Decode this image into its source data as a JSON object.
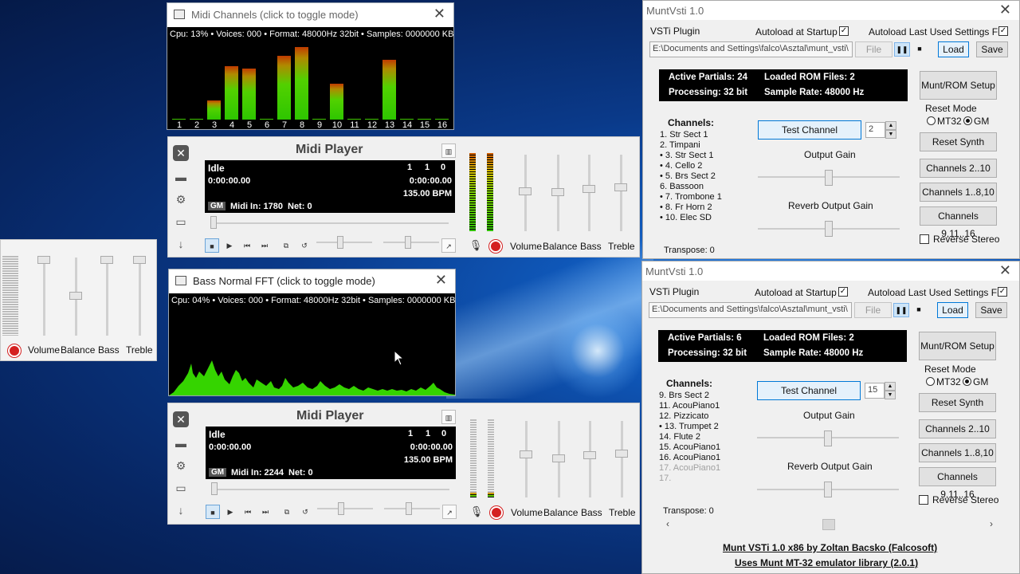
{
  "midi_channels": {
    "title": "Midi Channels (click to toggle mode)",
    "status": "Cpu: 13% • Voices: 000 • Format: 48000Hz 32bit • Samples: 0000000 KB",
    "channels": [
      "1",
      "2",
      "3",
      "4",
      "5",
      "6",
      "7",
      "8",
      "9",
      "10",
      "11",
      "12",
      "13",
      "14",
      "15",
      "16"
    ],
    "levels": [
      0,
      0,
      0.25,
      0.7,
      0.67,
      0,
      0.83,
      0.95,
      0,
      0.47,
      0,
      0,
      0.78,
      0,
      0,
      0
    ]
  },
  "bass_fft": {
    "title": "Bass Normal FFT (click to toggle mode)",
    "status": "Cpu: 04% • Voices: 000 • Format: 48000Hz 32bit • Samples: 0000000 KB"
  },
  "player1": {
    "title": "Midi Player",
    "state": "Idle",
    "time": "0:00:00.00",
    "pos1": "1",
    "pos2": "1",
    "pos3": "0",
    "time2": "0:00:00.00",
    "bpm": "135.00 BPM",
    "badge": "GM",
    "midi_in": "Midi In: 1780",
    "net": "Net: 0",
    "labels": {
      "volume": "Volume",
      "balance": "Balance",
      "bass": "Bass",
      "treble": "Treble"
    }
  },
  "player2": {
    "title": "Midi Player",
    "state": "Idle",
    "time": "0:00:00.00",
    "pos1": "1",
    "pos2": "1",
    "pos3": "0",
    "time2": "0:00:00.00",
    "bpm": "135.00 BPM",
    "badge": "GM",
    "midi_in": "Midi In: 2244",
    "net": "Net: 0",
    "labels": {
      "volume": "Volume",
      "balance": "Balance",
      "bass": "Bass",
      "treble": "Treble"
    }
  },
  "left_mixer": {
    "labels": {
      "volume": "Volume",
      "balance": "Balance",
      "bass": "Bass",
      "treble": "Treble"
    }
  },
  "munt1": {
    "title": "MuntVsti 1.0",
    "vsti_plugin": "VSTi Plugin",
    "autoload_startup": "Autoload at Startup",
    "autoload_last": "Autoload Last Used Settings File",
    "path": "E:\\Documents and Settings\\falco\\Asztal\\munt_vsti\\",
    "file": "File",
    "load": "Load",
    "save": "Save",
    "active_partials": "Active Partials: 24",
    "loaded_rom": "Loaded ROM Files: 2",
    "processing": "Processing: 32 bit",
    "sample_rate": "Sample Rate: 48000 Hz",
    "munt_rom_setup": "Munt/ROM Setup",
    "reset_mode": "Reset Mode",
    "mt32": "MT32",
    "gm": "GM",
    "reset_synth": "Reset Synth",
    "ch2_10": "Channels 2..10",
    "ch1_8_10": "Channels 1..8,10",
    "ch9_11_16": "Channels 9,11..16",
    "reverse_stereo": "Reverse Stereo",
    "channels_label": "Channels:",
    "test_channel": "Test Channel",
    "test_value": "2",
    "output_gain": "Output Gain",
    "reverb_output_gain": "Reverb Output Gain",
    "transpose": "Transpose: 0",
    "channels": [
      {
        "text": "1. Str Sect 1",
        "active": false
      },
      {
        "text": "2. Timpani",
        "active": false
      },
      {
        "text": "3. Str Sect 1",
        "active": true
      },
      {
        "text": "4. Cello 2",
        "active": true
      },
      {
        "text": "5. Brs Sect 2",
        "active": true
      },
      {
        "text": "6. Bassoon",
        "active": false
      },
      {
        "text": "7. Trombone 1",
        "active": true
      },
      {
        "text": "8. Fr Horn 2",
        "active": true
      },
      {
        "text": "10. Elec SD",
        "active": true
      }
    ]
  },
  "munt2": {
    "title": "MuntVsti 1.0",
    "vsti_plugin": "VSTi Plugin",
    "autoload_startup": "Autoload at Startup",
    "autoload_last": "Autoload Last Used Settings File",
    "path": "E:\\Documents and Settings\\falco\\Asztal\\munt_vsti\\",
    "file": "File",
    "load": "Load",
    "save": "Save",
    "active_partials": "Active Partials: 6",
    "loaded_rom": "Loaded ROM Files: 2",
    "processing": "Processing: 32 bit",
    "sample_rate": "Sample Rate: 48000 Hz",
    "munt_rom_setup": "Munt/ROM Setup",
    "reset_mode": "Reset Mode",
    "mt32": "MT32",
    "gm": "GM",
    "reset_synth": "Reset Synth",
    "ch2_10": "Channels 2..10",
    "ch1_8_10": "Channels 1..8,10",
    "ch9_11_16": "Channels 9,11..16",
    "reverse_stereo": "Reverse Stereo",
    "channels_label": "Channels:",
    "test_channel": "Test Channel",
    "test_value": "15",
    "output_gain": "Output Gain",
    "reverb_output_gain": "Reverb Output Gain",
    "transpose": "Transpose: 0",
    "channels": [
      {
        "text": "9. Brs Sect 2",
        "active": false
      },
      {
        "text": "11. AcouPiano1",
        "active": false
      },
      {
        "text": "12. Pizzicato",
        "active": false
      },
      {
        "text": "13. Trumpet 2",
        "active": true
      },
      {
        "text": "14. Flute 2",
        "active": false
      },
      {
        "text": "15. AcouPiano1",
        "active": false
      },
      {
        "text": "16. AcouPiano1",
        "active": false
      },
      {
        "text": "17. AcouPiano1",
        "active": false,
        "dim": true
      },
      {
        "text": "17.",
        "active": false,
        "dim": true
      }
    ],
    "credit1": "Munt VSTi 1.0 x86 by Zoltan Bacsko (Falcosoft)",
    "credit2": "Uses Munt MT-32 emulator library (2.0.1)"
  }
}
